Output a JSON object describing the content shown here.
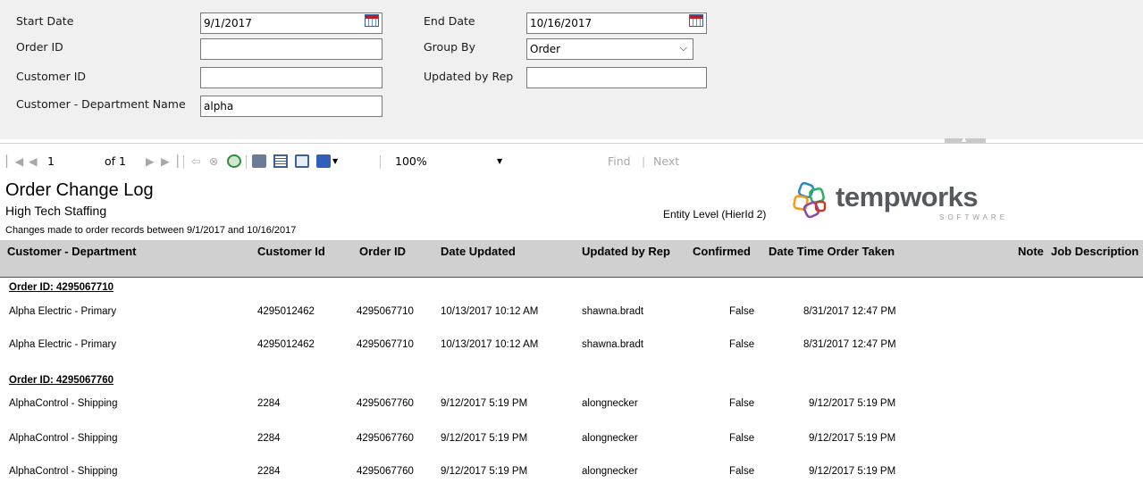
{
  "params": {
    "start_date_label": "Start Date",
    "start_date_value": "9/1/2017",
    "end_date_label": "End Date",
    "end_date_value": "10/16/2017",
    "order_id_label": "Order ID",
    "order_id_value": "",
    "group_by_label": "Group By",
    "group_by_value": "Order",
    "customer_id_label": "Customer ID",
    "customer_id_value": "",
    "updated_by_rep_label": "Updated by Rep",
    "updated_by_rep_value": "",
    "cust_dept_label": "Customer - Department Name",
    "cust_dept_value": "alpha"
  },
  "toolbar": {
    "page_current": "1",
    "page_of": "of 1",
    "zoom": "100%",
    "find": "Find",
    "separator": "|",
    "next": "Next"
  },
  "report": {
    "title": "Order Change Log",
    "company": "High Tech Staffing",
    "subtitle": "Changes made to order records between 9/1/2017 and 10/16/2017",
    "entity": "Entity Level (HierId 2)",
    "logo_text": "tempworks",
    "logo_sub": "SOFTWARE",
    "columns": {
      "customer_department": "Customer - Department",
      "customer_id": "Customer Id",
      "order_id": "Order ID",
      "date_updated": "Date Updated",
      "updated_by_rep": "Updated by Rep",
      "confirmed": "Confirmed",
      "date_time_order_taken": "Date Time Order Taken",
      "note": "Note",
      "job_description": "Job Description"
    },
    "groups": [
      {
        "header": "Order ID: 4295067710",
        "rows": [
          {
            "customer_department": "Alpha Electric - Primary",
            "customer_id": "4295012462",
            "order_id": "4295067710",
            "date_updated": "10/13/2017 10:12 AM",
            "updated_by_rep": "shawna.bradt",
            "confirmed": "False",
            "date_time_order_taken": "8/31/2017 12:47 PM"
          },
          {
            "customer_department": "Alpha Electric - Primary",
            "customer_id": "4295012462",
            "order_id": "4295067710",
            "date_updated": "10/13/2017 10:12 AM",
            "updated_by_rep": "shawna.bradt",
            "confirmed": "False",
            "date_time_order_taken": "8/31/2017 12:47 PM"
          }
        ]
      },
      {
        "header": "Order ID: 4295067760",
        "rows": [
          {
            "customer_department": "AlphaControl - Shipping",
            "customer_id": "2284",
            "order_id": "4295067760",
            "date_updated": "9/12/2017 5:19 PM",
            "updated_by_rep": "alongnecker",
            "confirmed": "False",
            "date_time_order_taken": "9/12/2017 5:19 PM"
          },
          {
            "customer_department": "AlphaControl - Shipping",
            "customer_id": "2284",
            "order_id": "4295067760",
            "date_updated": "9/12/2017 5:19 PM",
            "updated_by_rep": "alongnecker",
            "confirmed": "False",
            "date_time_order_taken": "9/12/2017 5:19 PM"
          },
          {
            "customer_department": "AlphaControl - Shipping",
            "customer_id": "2284",
            "order_id": "4295067760",
            "date_updated": "9/12/2017 5:19 PM",
            "updated_by_rep": "alongnecker",
            "confirmed": "False",
            "date_time_order_taken": "9/12/2017 5:19 PM"
          }
        ]
      }
    ]
  }
}
